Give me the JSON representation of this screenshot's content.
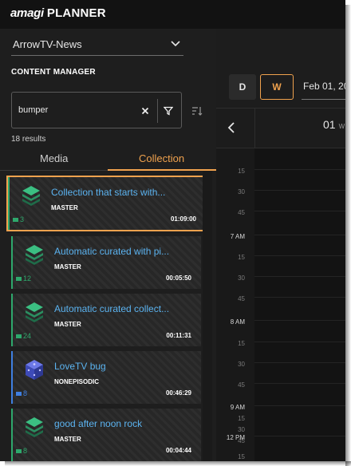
{
  "app": {
    "brand_logo": "amagi",
    "brand_product": "PLANNER"
  },
  "channel_select": {
    "value": "ArrowTV-News"
  },
  "content_manager": {
    "title": "CONTENT MANAGER",
    "search_value": "bumper",
    "results_text": "18 results",
    "tabs": {
      "media": "Media",
      "collection": "Collection",
      "active": "Collection"
    },
    "items": [
      {
        "title": "Collection that starts with...",
        "type": "MASTER",
        "count": "3",
        "duration": "01:09:00",
        "accent": "#2ea86c",
        "selected": true
      },
      {
        "title": "Automatic curated with pi...",
        "type": "MASTER",
        "count": "12",
        "duration": "00:05:50",
        "accent": "#2ea86c",
        "selected": false
      },
      {
        "title": "Automatic curated collect...",
        "type": "MASTER",
        "count": "24",
        "duration": "00:11:31",
        "accent": "#2ea86c",
        "selected": false
      },
      {
        "title": "LoveTV bug",
        "type": "NONEPISODIC",
        "count": "8",
        "duration": "00:46:29",
        "accent": "#3f7fe0",
        "selected": false
      },
      {
        "title": "good after noon rock",
        "type": "MASTER",
        "count": "8",
        "duration": "00:04:44",
        "accent": "#2ea86c",
        "selected": false
      }
    ]
  },
  "calendar": {
    "view_day": "D",
    "view_week": "W",
    "active_view": "W",
    "date_value": "Feb 01, 20",
    "day_number": "01",
    "day_suffix": "W",
    "time_ticks": [
      "15",
      "30",
      "45",
      "7 AM",
      "15",
      "30",
      "45",
      "8 AM",
      "15",
      "30",
      "45",
      "9 AM",
      "15",
      "30",
      "45",
      "12 PM",
      "15"
    ]
  },
  "colors": {
    "accent_orange": "#f0a24e",
    "link_blue": "#5bb3f0",
    "master_green": "#2ea86c",
    "nonepisodic_blue": "#3f7fe0"
  }
}
